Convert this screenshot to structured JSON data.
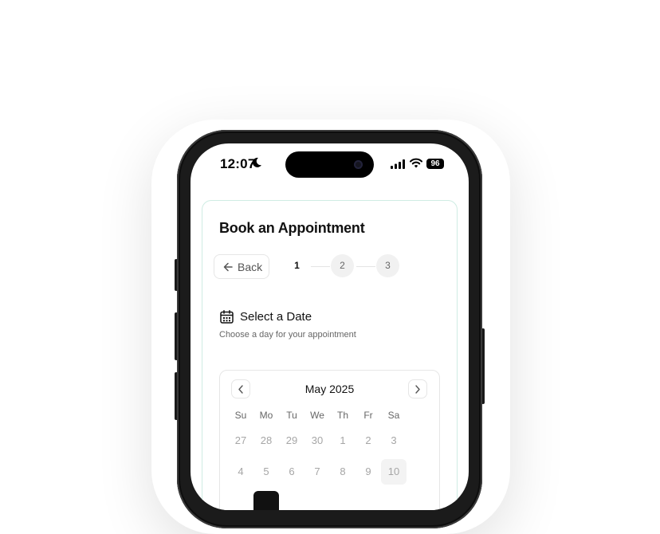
{
  "status_bar": {
    "time": "12:07",
    "battery": "96",
    "icons": [
      "moon-icon",
      "signal-icon",
      "wifi-icon"
    ]
  },
  "card": {
    "title": "Book an Appointment",
    "back_label": "Back",
    "steps": [
      "1",
      "2",
      "3"
    ],
    "active_step": "1",
    "section_title": "Select a Date",
    "section_subtitle": "Choose a day for your appointment"
  },
  "calendar": {
    "month": "May 2025",
    "weekdays": [
      "Su",
      "Mo",
      "Tu",
      "We",
      "Th",
      "Fr",
      "Sa"
    ],
    "weeks": [
      [
        "27",
        "28",
        "29",
        "30",
        "1",
        "2",
        "3"
      ],
      [
        "4",
        "5",
        "6",
        "7",
        "8",
        "9",
        "10"
      ]
    ],
    "highlighted_day": "10"
  },
  "colors": {
    "accent": "#111111",
    "card_border": "#cfece3",
    "muted_text": "#a6a6a6"
  }
}
